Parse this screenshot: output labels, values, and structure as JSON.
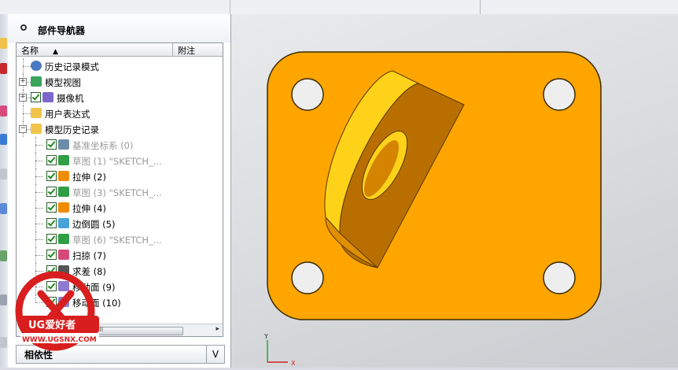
{
  "panel": {
    "title": "部件导航器",
    "col_name": "名称",
    "col_note": "附注",
    "dependents_label": "相依性"
  },
  "tree": [
    {
      "label": "历史记录模式",
      "icon": "clock-icon",
      "dim": false
    },
    {
      "label": "模型视图",
      "icon": "model-view-icon",
      "dim": false
    },
    {
      "label": "摄像机",
      "icon": "camera-icon",
      "dim": false
    },
    {
      "label": "用户表达式",
      "icon": "folder-icon",
      "dim": false
    },
    {
      "label": "模型历史记录",
      "icon": "folder-icon",
      "dim": false
    },
    {
      "label": "基准坐标系 (0)",
      "icon": "datum-csys-icon",
      "dim": true
    },
    {
      "label": "草图 (1) \"SKETCH_...",
      "icon": "sketch-icon",
      "dim": true
    },
    {
      "label": "拉伸 (2)",
      "icon": "extrude-icon",
      "dim": false
    },
    {
      "label": "草图 (3) \"SKETCH_...",
      "icon": "sketch-icon",
      "dim": true
    },
    {
      "label": "拉伸 (4)",
      "icon": "extrude-icon",
      "dim": false
    },
    {
      "label": "边倒圆 (5)",
      "icon": "edge-blend-icon",
      "dim": false
    },
    {
      "label": "草图 (6) \"SKETCH_...",
      "icon": "sketch-icon",
      "dim": true
    },
    {
      "label": "扫掠 (7)",
      "icon": "swept-icon",
      "dim": false
    },
    {
      "label": "求差 (8)",
      "icon": "subtract-icon",
      "dim": false
    },
    {
      "label": "移动面 (9)",
      "icon": "move-face-icon",
      "dim": false
    },
    {
      "label": "移动面 (10)",
      "icon": "move-face-icon",
      "dim": false
    }
  ],
  "scroll": {
    "left": "◂",
    "right": "▸",
    "grip": "III"
  },
  "watermark": {
    "brand": "UG爱好者",
    "url": "WWW.UGSNX.COM"
  },
  "triad": {
    "y": "Y",
    "x": "X"
  },
  "colors": {
    "part": "#ffa500",
    "part_edge": "#3a2a00",
    "boss_front": "#e8a000",
    "boss_top": "#ffd21a",
    "boss_side": "#b86f00"
  }
}
